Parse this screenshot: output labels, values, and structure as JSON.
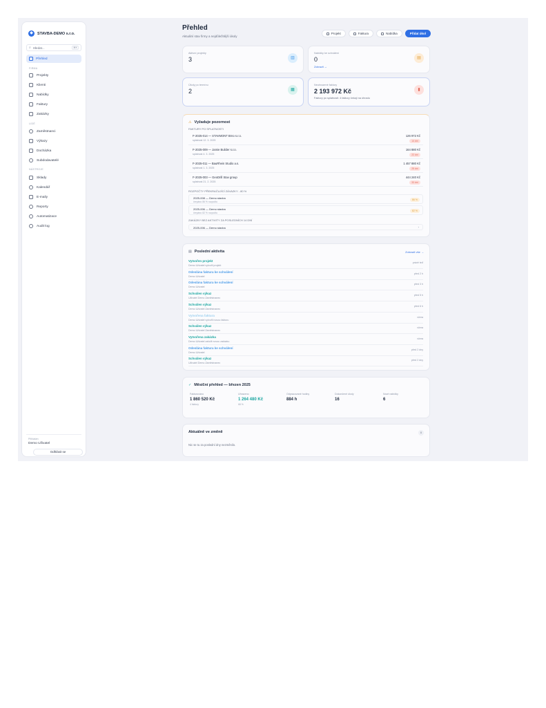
{
  "sidebar": {
    "brand": "STAVBA-DEMO s.r.o.",
    "search_placeholder": "Hledat...",
    "search_shortcut": "⌘K",
    "active_item": "Přehled",
    "sections": [
      {
        "label": "FIRMA",
        "items": [
          "Projekty",
          "Klienti",
          "Nabídky",
          "Faktury",
          "Zakázky"
        ]
      },
      {
        "label": "LIDÉ",
        "items": [
          "Zaměstnanci",
          "Výkazy",
          "Docházka",
          "Subdodavatelé"
        ]
      },
      {
        "label": "NÁSTROJE",
        "items": [
          "Sklady",
          "Kalendář",
          "E-maily",
          "Reporty",
          "Automatizace",
          "Audit log"
        ]
      }
    ],
    "user_caption": "Přihlášen",
    "user_name": "Demo Uživatel",
    "logout": "Odhlásit se"
  },
  "header": {
    "title": "Přehled",
    "subtitle": "Aktuální stav firmy a nejdůležitější úkoly",
    "buttons": [
      "Projekt",
      "Faktura",
      "Nabídka",
      "Přidat úkol"
    ]
  },
  "stats": [
    {
      "label": "Aktivní projekty",
      "value": "3",
      "note": ""
    },
    {
      "label": "Nabídky ke schválení",
      "value": "0",
      "note": "Zobrazit →"
    },
    {
      "label": "Úkoly po termínu",
      "value": "2",
      "note": ""
    },
    {
      "label": "Neuhrazené faktury",
      "value": "2 193 972 Kč",
      "note": "Faktury po splatnosti: 4 faktury čekají na úhradu"
    }
  ],
  "attention": {
    "title": "Vyžaduje pozornost",
    "invoices_heading": "FAKTURY PO SPLATNOSTI",
    "invoices": [
      {
        "name": "F-2025-014 — STAVMONT Brno s.r.o.",
        "date": "splatnost 12. 3. 2025",
        "amount": "126 972 Kč",
        "badge": "14 dní"
      },
      {
        "name": "F-2025-009 — Jamie Builder s.r.o.",
        "date": "splatnost 4. 3. 2025",
        "amount": "164 880 Kč",
        "badge": "22 dní"
      },
      {
        "name": "F-2025-011 — BauRhein Studio a.s.",
        "date": "splatnost 1. 3. 2025",
        "amount": "1 457 880 Kč",
        "badge": "25 dní"
      },
      {
        "name": "F-2025-003 — GeoDrill Stav group",
        "date": "splatnost 21. 2. 2025",
        "amount": "444 240 Kč",
        "badge": "33 dní"
      }
    ],
    "builds_heading": "ROZPOČTY PŘEKRAČUJÍCÍ ZÁVAZKY - 80 %",
    "builds": [
      {
        "name": "2025-008 — Demo stavba",
        "sub": "čerpáno 86 % rozpočtu",
        "badge": "86 %"
      },
      {
        "name": "2025-006 — Demo stavba",
        "sub": "čerpáno 82 % rozpočtu",
        "badge": "82 %"
      }
    ],
    "single_heading": "ZAKÁZKY BEZ AKTIVITY ZA POSLEDNÍCH 14 DNÍ",
    "single": "2025-006 — Demo stavba"
  },
  "activity": {
    "title": "Poslední aktivita",
    "link": "Zobrazit vše →",
    "items": [
      {
        "title": "Vytvořen projekt",
        "desc": "Demo Uživatel vytvořil projekt",
        "time": "právě teď",
        "color": "#1aa6a0"
      },
      {
        "title": "Odeslána faktura ke schválení",
        "desc": "Demo Uživatel",
        "time": "před 2 h",
        "color": "#4a9be8"
      },
      {
        "title": "Odeslána faktura ke schválení",
        "desc": "Demo Uživatel",
        "time": "před 3 h",
        "color": "#4a9be8"
      },
      {
        "title": "Schválen výkaz",
        "desc": "Uživatel Demo Zaměstnanec",
        "time": "před 5 h",
        "color": "#1aa6a0"
      },
      {
        "title": "Schválen výkaz",
        "desc": "Demo Uživatel Zaměstnanec",
        "time": "před 6 h",
        "color": "#1aa6a0"
      },
      {
        "title": "Vytvořena faktura",
        "desc": "Demo Uživatel vytvořil novou fakturu",
        "time": "včera",
        "color": "#9ed0f0"
      },
      {
        "title": "Schválen výkaz",
        "desc": "Demo Uživatel Zaměstnanec",
        "time": "včera",
        "color": "#1aa6a0"
      },
      {
        "title": "Vytvořena zakázka",
        "desc": "Demo Uživatel založil novou zakázku",
        "time": "včera",
        "color": "#1aa6a0"
      },
      {
        "title": "Odeslána faktura ke schválení",
        "desc": "Demo Uživatel",
        "time": "před 2 dny",
        "color": "#4a9be8"
      },
      {
        "title": "Schválen výkaz",
        "desc": "Uživatel Demo Zaměstnanec",
        "time": "před 2 dny",
        "color": "#1aa6a0"
      }
    ]
  },
  "monthly": {
    "title": "Měsíční přehled — březen 2025",
    "kpis": [
      {
        "label": "Fakturováno",
        "value": "1 860 520 Kč",
        "sub": "4 faktury",
        "color": "#1f2a3d"
      },
      {
        "label": "Uhrazeno",
        "value": "1 264 480 Kč",
        "sub": "68 %",
        "color": "#1aa6a0"
      },
      {
        "label": "Odpracované hodiny",
        "value": "884 h",
        "sub": "",
        "color": "#1f2a3d"
      },
      {
        "label": "Dokončené úkoly",
        "value": "16",
        "sub": "",
        "color": "#1f2a3d"
      },
      {
        "label": "Nové nabídky",
        "value": "6",
        "sub": "",
        "color": "#1f2a3d"
      }
    ]
  },
  "news": {
    "title": "Aktuálně ve změně",
    "count": "0",
    "empty": "Nic se tu za poslední dny nezměnilo."
  }
}
